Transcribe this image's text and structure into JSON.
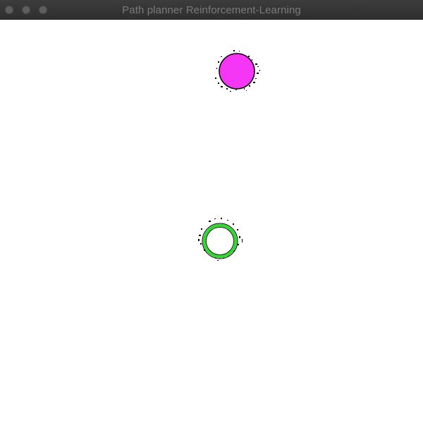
{
  "window": {
    "title": "Path planner Reinforcement-Learning"
  },
  "canvas": {
    "background": "#ffffff",
    "agent": {
      "shape": "filled-circle",
      "fill": "#f536f5",
      "stroke": "#000000"
    },
    "goal": {
      "shape": "ring",
      "stroke": "#33d633",
      "outline": "#000000",
      "fill": "#ffffff"
    }
  },
  "colors": {
    "titlebar": "#333333",
    "title_text": "#7a7a7a",
    "traffic_light": "#5e5e5e"
  }
}
